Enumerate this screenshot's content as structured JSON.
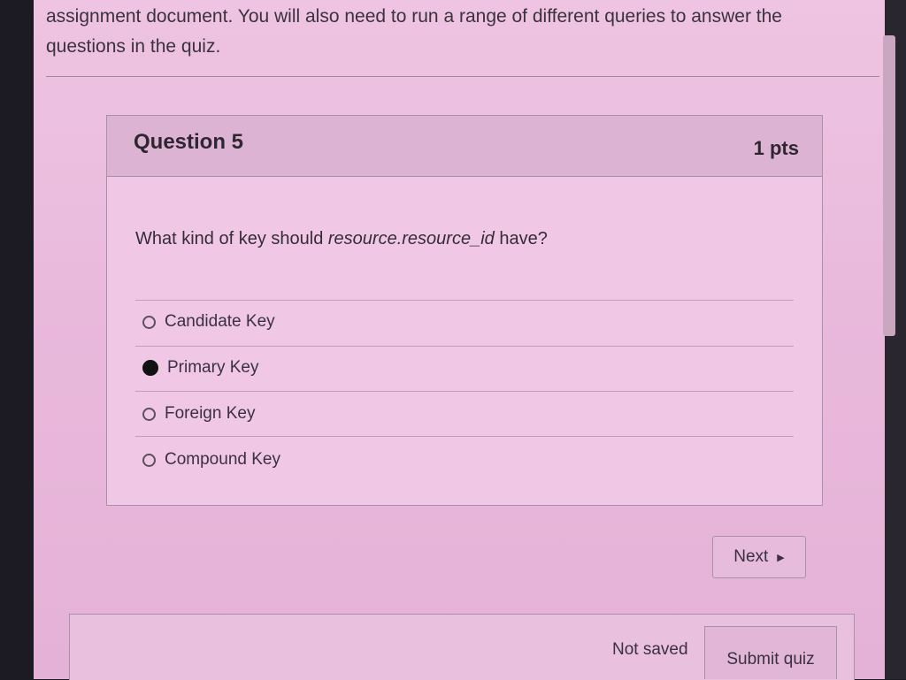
{
  "intro": {
    "line1": "assignment document. You will also need to run a range of different queries to answer the",
    "line2": "questions in the quiz."
  },
  "question": {
    "title": "Question 5",
    "points": "1 pts",
    "text_prefix": "What kind of key should ",
    "text_code": "resource.resource_id",
    "text_suffix": " have?",
    "answers": [
      {
        "label": "Candidate Key",
        "selected": false
      },
      {
        "label": "Primary Key",
        "selected": true
      },
      {
        "label": "Foreign Key",
        "selected": false
      },
      {
        "label": "Compound Key",
        "selected": false
      }
    ]
  },
  "nav": {
    "next_label": "Next",
    "next_icon": "triangle-right-icon"
  },
  "footer": {
    "status": "Not saved",
    "submit_label": "Submit quiz"
  }
}
